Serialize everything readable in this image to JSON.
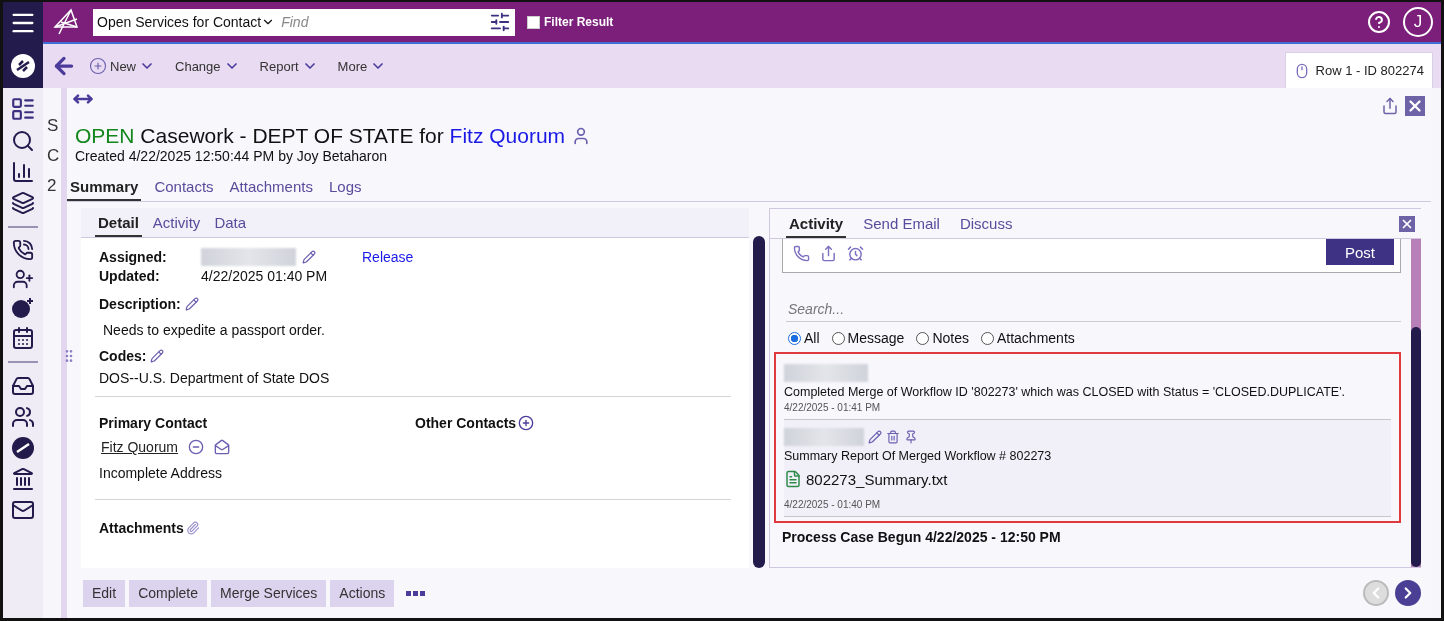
{
  "app_bar": {
    "view_select": "Open Services for Contact",
    "search": {
      "placeholder": "Find"
    },
    "filter_result": {
      "label": "Filter Result",
      "checked": false
    },
    "avatar": "J"
  },
  "toolbar": {
    "items": [
      {
        "label": "New",
        "kind": "add"
      },
      {
        "label": "Change",
        "kind": "menu"
      },
      {
        "label": "Report",
        "kind": "menu"
      },
      {
        "label": "More",
        "kind": "menu"
      }
    ],
    "record_tab": "Row 1 - ID 802274"
  },
  "list_behind": [
    "S",
    "C",
    "2"
  ],
  "case": {
    "status": "OPEN",
    "title": "Casework - DEPT OF STATE for",
    "contact": "Fitz Quorum",
    "created": "Created 4/22/2025 12:50:44 PM by Joy Betaharon"
  },
  "tabs": [
    {
      "label": "Summary",
      "selected": true
    },
    {
      "label": "Contacts",
      "selected": false
    },
    {
      "label": "Attachments",
      "selected": false
    },
    {
      "label": "Logs",
      "selected": false
    }
  ],
  "detail": {
    "tabs": [
      {
        "label": "Detail",
        "selected": true
      },
      {
        "label": "Activity",
        "selected": false
      },
      {
        "label": "Data",
        "selected": false
      }
    ],
    "assigned": {
      "label": "Assigned:",
      "action": "Release"
    },
    "updated": {
      "label": "Updated:",
      "value": "4/22/2025 01:40 PM"
    },
    "description": {
      "label": "Description:",
      "value": "Needs to expedite a passport order."
    },
    "codes": {
      "label": "Codes:",
      "value": "DOS--U.S. Department of State DOS"
    },
    "primary_contact": {
      "heading": "Primary Contact",
      "name": "Fitz Quorum",
      "address": "Incomplete Address"
    },
    "other_contacts": {
      "heading": "Other Contacts"
    },
    "attachments": {
      "heading": "Attachments"
    }
  },
  "actions": [
    "Edit",
    "Complete",
    "Merge Services",
    "Actions"
  ],
  "activity": {
    "tabs": [
      {
        "label": "Activity",
        "selected": true
      },
      {
        "label": "Send Email",
        "selected": false
      },
      {
        "label": "Discuss",
        "selected": false
      }
    ],
    "post": "Post",
    "search": {
      "placeholder": "Search..."
    },
    "filters": [
      {
        "label": "All",
        "selected": true
      },
      {
        "label": "Message",
        "selected": false
      },
      {
        "label": "Notes",
        "selected": false
      },
      {
        "label": "Attachments",
        "selected": false
      }
    ],
    "entries": [
      {
        "kind": "message",
        "text": "Completed Merge of Workflow ID '802273' which was CLOSED with Status = 'CLOSED.DUPLICATE'.",
        "time": "4/22/2025 - 01:41 PM"
      },
      {
        "kind": "note",
        "text": "Summary Report Of Merged Workflow # 802273",
        "file": "802273_Summary.txt",
        "time": "4/22/2025 - 01:40 PM"
      }
    ],
    "section": "Process Case Begun 4/22/2025 - 12:50 PM"
  }
}
